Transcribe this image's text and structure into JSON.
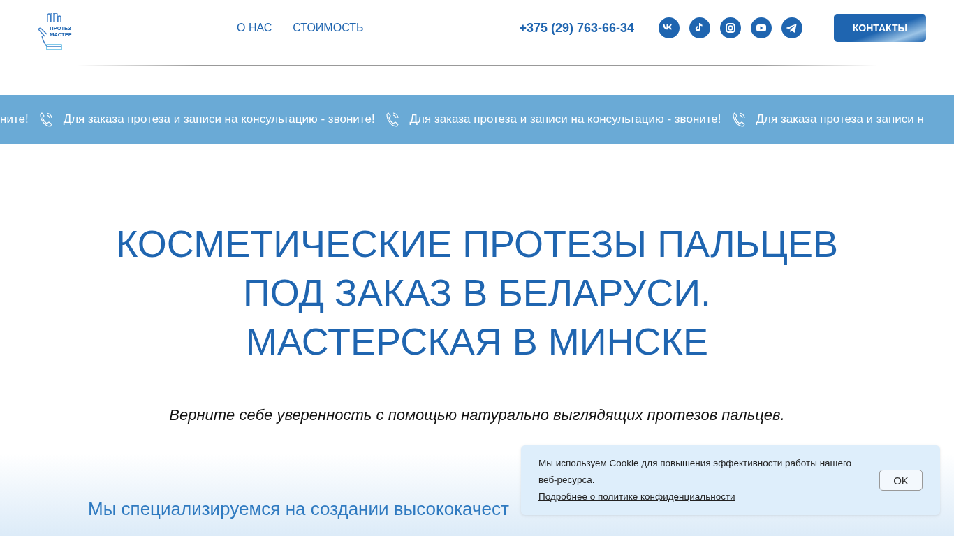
{
  "logo": {
    "line_1": "ПРОТЕЗ",
    "line_2": "МАСТЕР"
  },
  "nav": [
    {
      "label": "О НАС"
    },
    {
      "label": "СТОИМОСТЬ"
    }
  ],
  "phone": "+375 (29) 763-66-34",
  "socials": [
    {
      "kind": "vk"
    },
    {
      "kind": "tiktok"
    },
    {
      "kind": "instagram"
    },
    {
      "kind": "youtube"
    },
    {
      "kind": "telegram"
    }
  ],
  "contacts_button": "КОНТАКТЫ",
  "ticker": [
    {
      "text": "ните!",
      "icon": false
    },
    {
      "text": "Для заказа протеза и записи на консультацию - звоните!",
      "icon": true
    },
    {
      "text": "Для заказа протеза и записи на консультацию - звоните!",
      "icon": true
    },
    {
      "text": "Для заказа протеза и записи н",
      "icon": true
    }
  ],
  "hero": {
    "title": [
      "КОСМЕТИЧЕСКИЕ ПРОТЕЗЫ ПАЛЬЦЕВ",
      "ПОД ЗАКАЗ В БЕЛАРУСИ.",
      "МАСТЕРСКАЯ В МИНСКЕ"
    ],
    "subtitle": "Верните себе уверенность с помощью натурально выглядящих протезов пальцев."
  },
  "intro": "Мы специализируемся на создании высококачест",
  "cookie": {
    "text": "Мы используем Cookie для повышения эффективности работы нашего веб-ресурса.",
    "link": "Подробнее о политике конфиденциальности",
    "button": "OK"
  }
}
